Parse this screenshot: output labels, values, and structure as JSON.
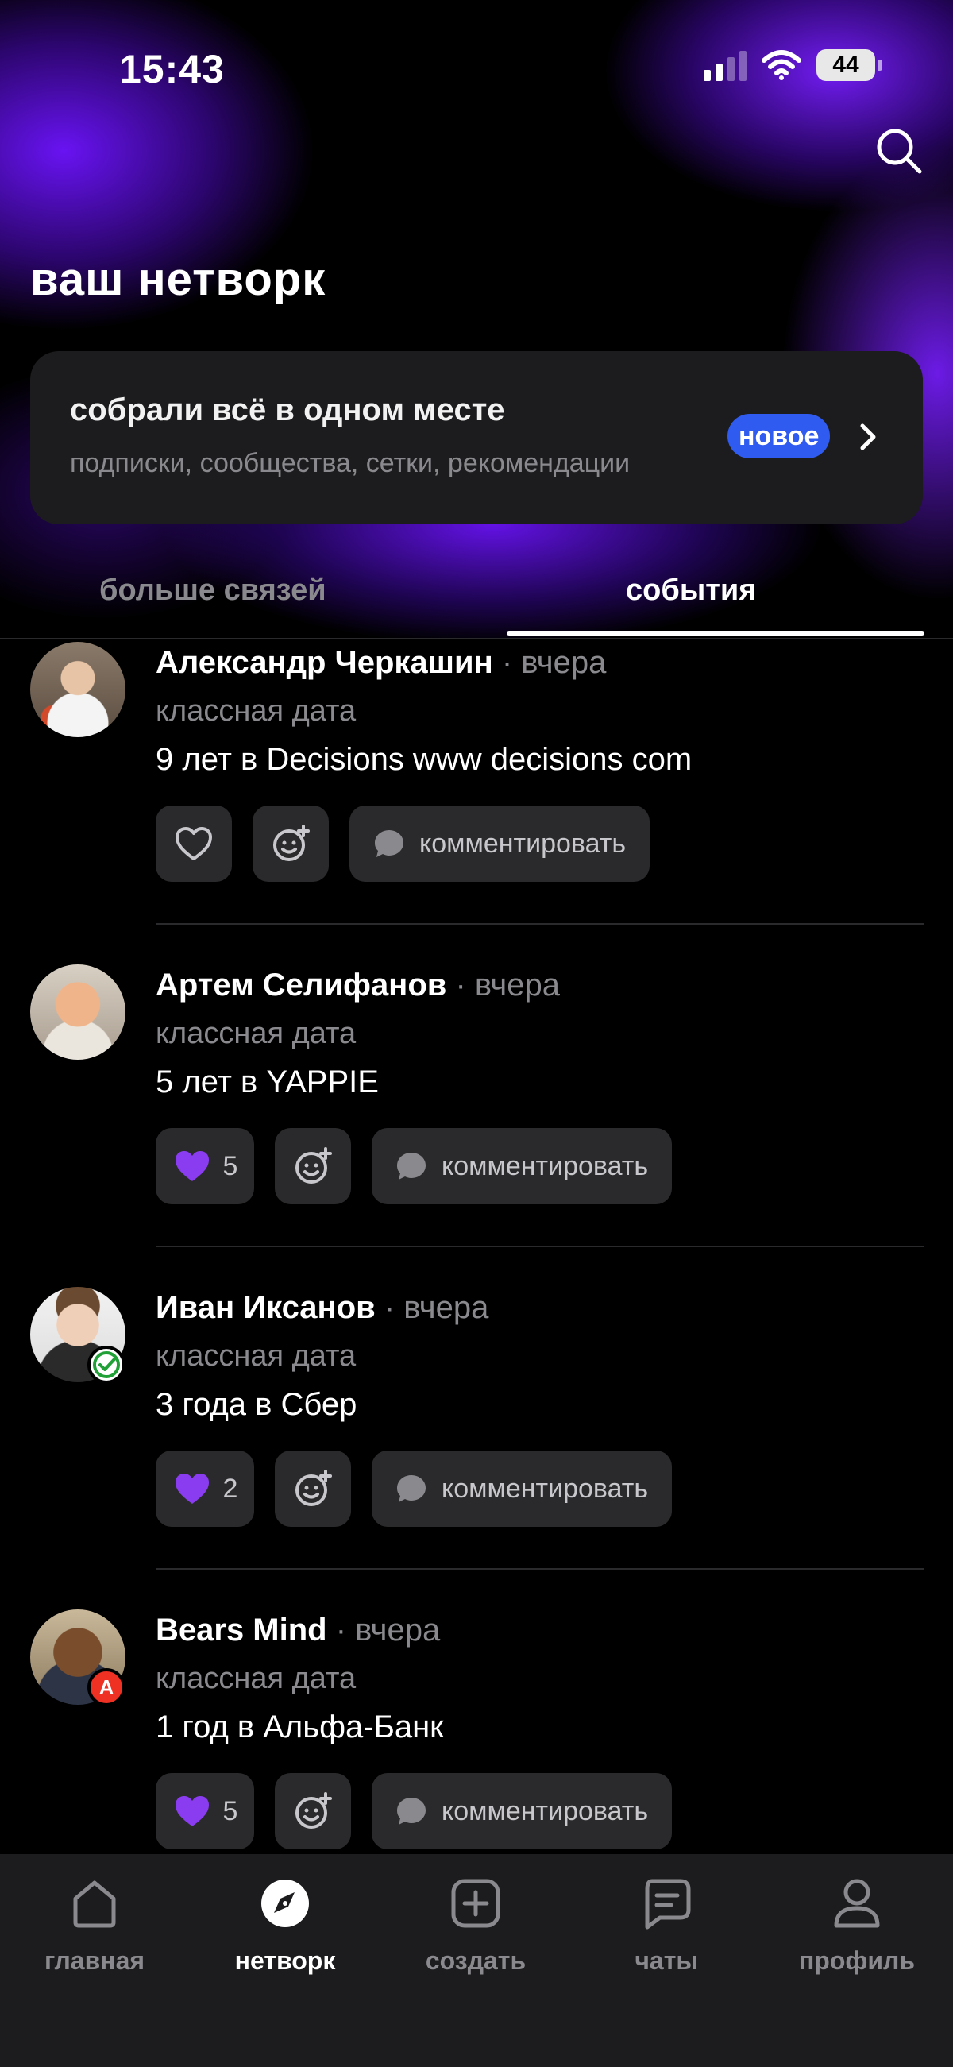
{
  "status_bar": {
    "time": "15:43",
    "battery": "44"
  },
  "header": {
    "title": "ваш нетворк"
  },
  "banner": {
    "title": "собрали всё в одном месте",
    "subtitle": "подписки, сообщества, сетки, рекомендации",
    "badge": "новое"
  },
  "tabs": [
    {
      "label": "больше связей",
      "active": false
    },
    {
      "label": "события",
      "active": true
    }
  ],
  "posts": [
    {
      "name": "Александр Черкашин",
      "time": "· вчера",
      "subtitle": "классная дата",
      "text": "9 лет в Decisions www decisions com",
      "likes": "",
      "comment_label": "комментировать"
    },
    {
      "name": "Артем Селифанов",
      "time": "· вчера",
      "subtitle": "классная дата",
      "text": "5 лет в YAPPIE",
      "likes": "5",
      "comment_label": "комментировать"
    },
    {
      "name": "Иван Иксанов",
      "time": "· вчера",
      "subtitle": "классная дата",
      "text": "3 года в Сбер",
      "likes": "2",
      "comment_label": "комментировать"
    },
    {
      "name": "Bears Mind",
      "time": "· вчера",
      "subtitle": "классная дата",
      "text": "1 год в Альфа-Банк",
      "likes": "5",
      "comment_label": "комментировать",
      "badge_letter": "А"
    }
  ],
  "navbar": [
    {
      "label": "главная",
      "icon": "home-icon"
    },
    {
      "label": "нетворк",
      "icon": "compass-icon",
      "active": true
    },
    {
      "label": "создать",
      "icon": "plus-square-icon"
    },
    {
      "label": "чаты",
      "icon": "chat-icon"
    },
    {
      "label": "профиль",
      "icon": "profile-icon"
    }
  ],
  "colors": {
    "accent": "#2f5bf0",
    "heart": "#8a3cf0",
    "background": "#000000",
    "surface": "#1c1c1e"
  }
}
